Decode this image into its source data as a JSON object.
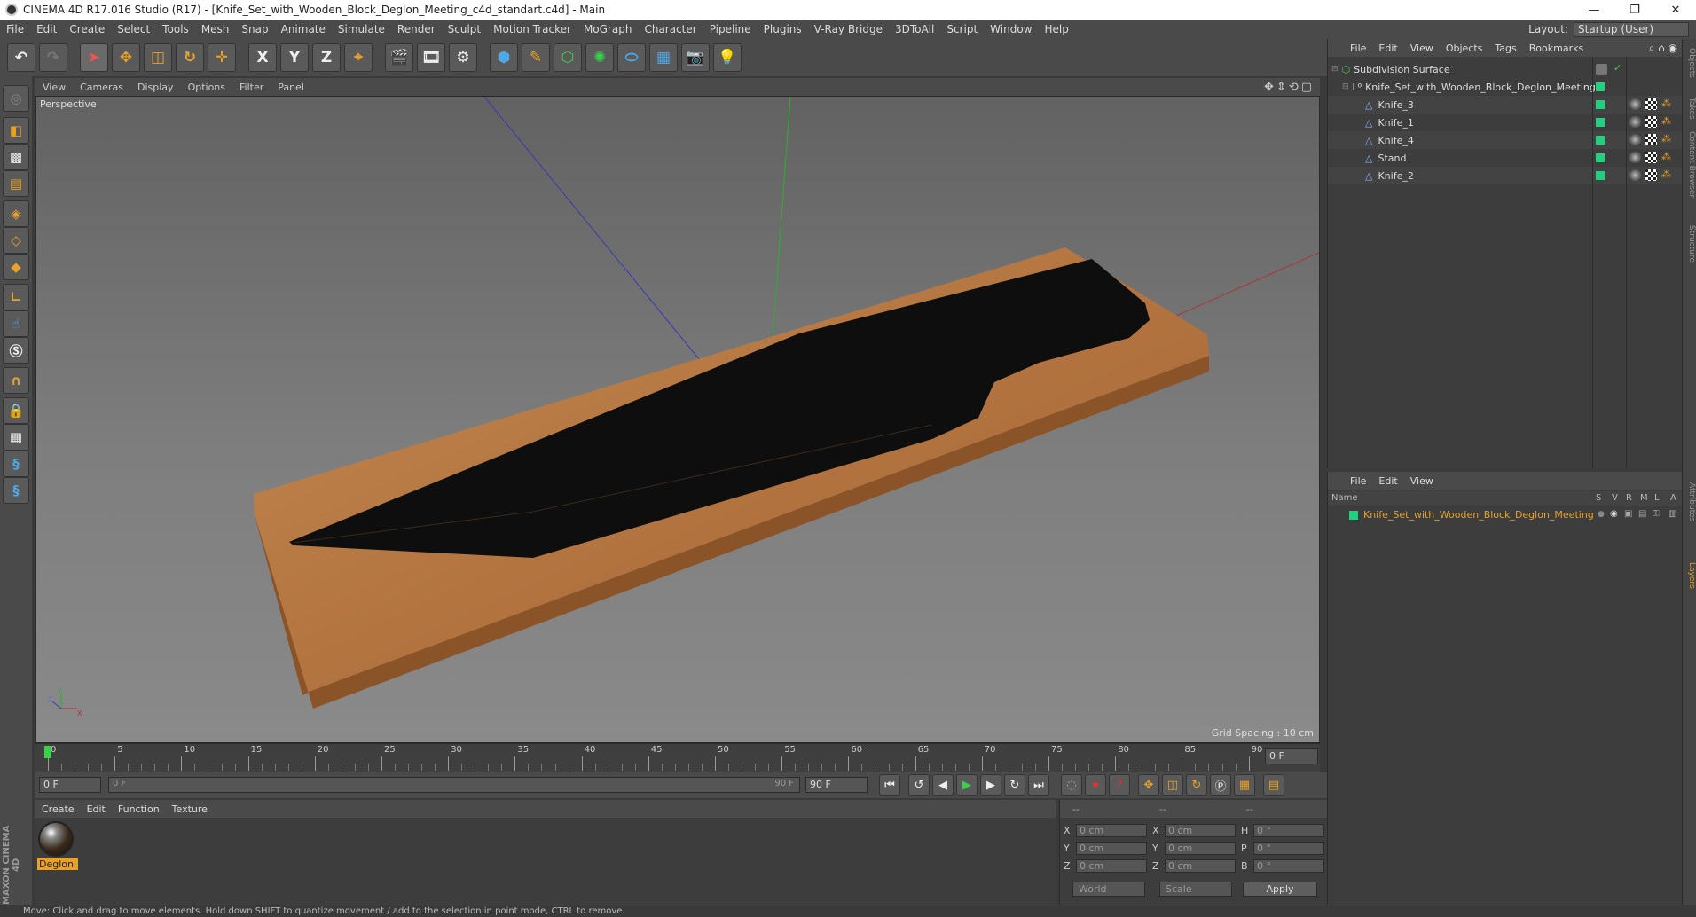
{
  "window": {
    "title": "CINEMA 4D R17.016 Studio (R17) - [Knife_Set_with_Wooden_Block_Deglon_Meeting_c4d_standart.c4d] - Main",
    "controls": [
      "—",
      "❐",
      "✕"
    ]
  },
  "menubar": {
    "items": [
      "File",
      "Edit",
      "Create",
      "Select",
      "Tools",
      "Mesh",
      "Snap",
      "Animate",
      "Simulate",
      "Render",
      "Sculpt",
      "Motion Tracker",
      "MoGraph",
      "Character",
      "Pipeline",
      "Plugins",
      "V-Ray Bridge",
      "3DToAll",
      "Script",
      "Window",
      "Help"
    ],
    "layout_label": "Layout:",
    "layout_value": "Startup (User)"
  },
  "toolbar": {
    "axis_x": "X",
    "axis_y": "Y",
    "axis_z": "Z"
  },
  "viewport": {
    "menu": [
      "View",
      "Cameras",
      "Display",
      "Options",
      "Filter",
      "Panel"
    ],
    "label": "Perspective",
    "grid_spacing": "Grid Spacing : 10 cm",
    "axis_gizmo": {
      "y": "Y",
      "x": "X",
      "z": "Z"
    }
  },
  "timeline": {
    "ticks": [
      "0",
      "5",
      "10",
      "15",
      "20",
      "25",
      "30",
      "35",
      "40",
      "45",
      "50",
      "55",
      "60",
      "65",
      "70",
      "75",
      "80",
      "85",
      "90"
    ],
    "current_frame": "0 F"
  },
  "transport": {
    "start_field": "0 F",
    "range_start": "0 F",
    "range_end": "90 F",
    "end_field": "90 F"
  },
  "material_manager": {
    "menu": [
      "Create",
      "Edit",
      "Function",
      "Texture"
    ],
    "materials": [
      {
        "name": "Deglon"
      }
    ]
  },
  "coordinates": {
    "header": [
      "--",
      "--",
      "--"
    ],
    "rows": [
      {
        "k1": "X",
        "v1": "0 cm",
        "k2": "X",
        "v2": "0 cm",
        "k3": "H",
        "v3": "0 °"
      },
      {
        "k1": "Y",
        "v1": "0 cm",
        "k2": "Y",
        "v2": "0 cm",
        "k3": "P",
        "v3": "0 °"
      },
      {
        "k1": "Z",
        "v1": "0 cm",
        "k2": "Z",
        "v2": "0 cm",
        "k3": "B",
        "v3": "0 °"
      }
    ],
    "mode": "World",
    "measure": "Scale",
    "apply": "Apply"
  },
  "object_manager": {
    "menu": [
      "File",
      "Edit",
      "View",
      "Objects",
      "Tags",
      "Bookmarks"
    ],
    "objects": [
      {
        "name": "Subdivision Surface",
        "level": 0
      },
      {
        "name": "Knife_Set_with_Wooden_Block_Deglon_Meeting",
        "level": 1
      },
      {
        "name": "Knife_3",
        "level": 2
      },
      {
        "name": "Knife_1",
        "level": 2
      },
      {
        "name": "Knife_4",
        "level": 2
      },
      {
        "name": "Stand",
        "level": 2
      },
      {
        "name": "Knife_2",
        "level": 2
      }
    ]
  },
  "layer_manager": {
    "menu": [
      "File",
      "Edit",
      "View"
    ],
    "header": {
      "name": "Name",
      "cols": [
        "S",
        "V",
        "R",
        "M",
        "L",
        "A"
      ]
    },
    "layers": [
      {
        "name": "Knife_Set_with_Wooden_Block_Deglon_Meeting",
        "color": "#1fd17f"
      }
    ]
  },
  "side_tabs": [
    "Objects",
    "Takes",
    "Content Browser",
    "Structure",
    "Attributes",
    "Layers"
  ],
  "status": "Move: Click and drag to move elements. Hold down SHIFT to quantize movement / add to the selection in point mode, CTRL to remove.",
  "colors": {
    "accent": "#e9a227",
    "layer_green": "#1fd17f"
  }
}
